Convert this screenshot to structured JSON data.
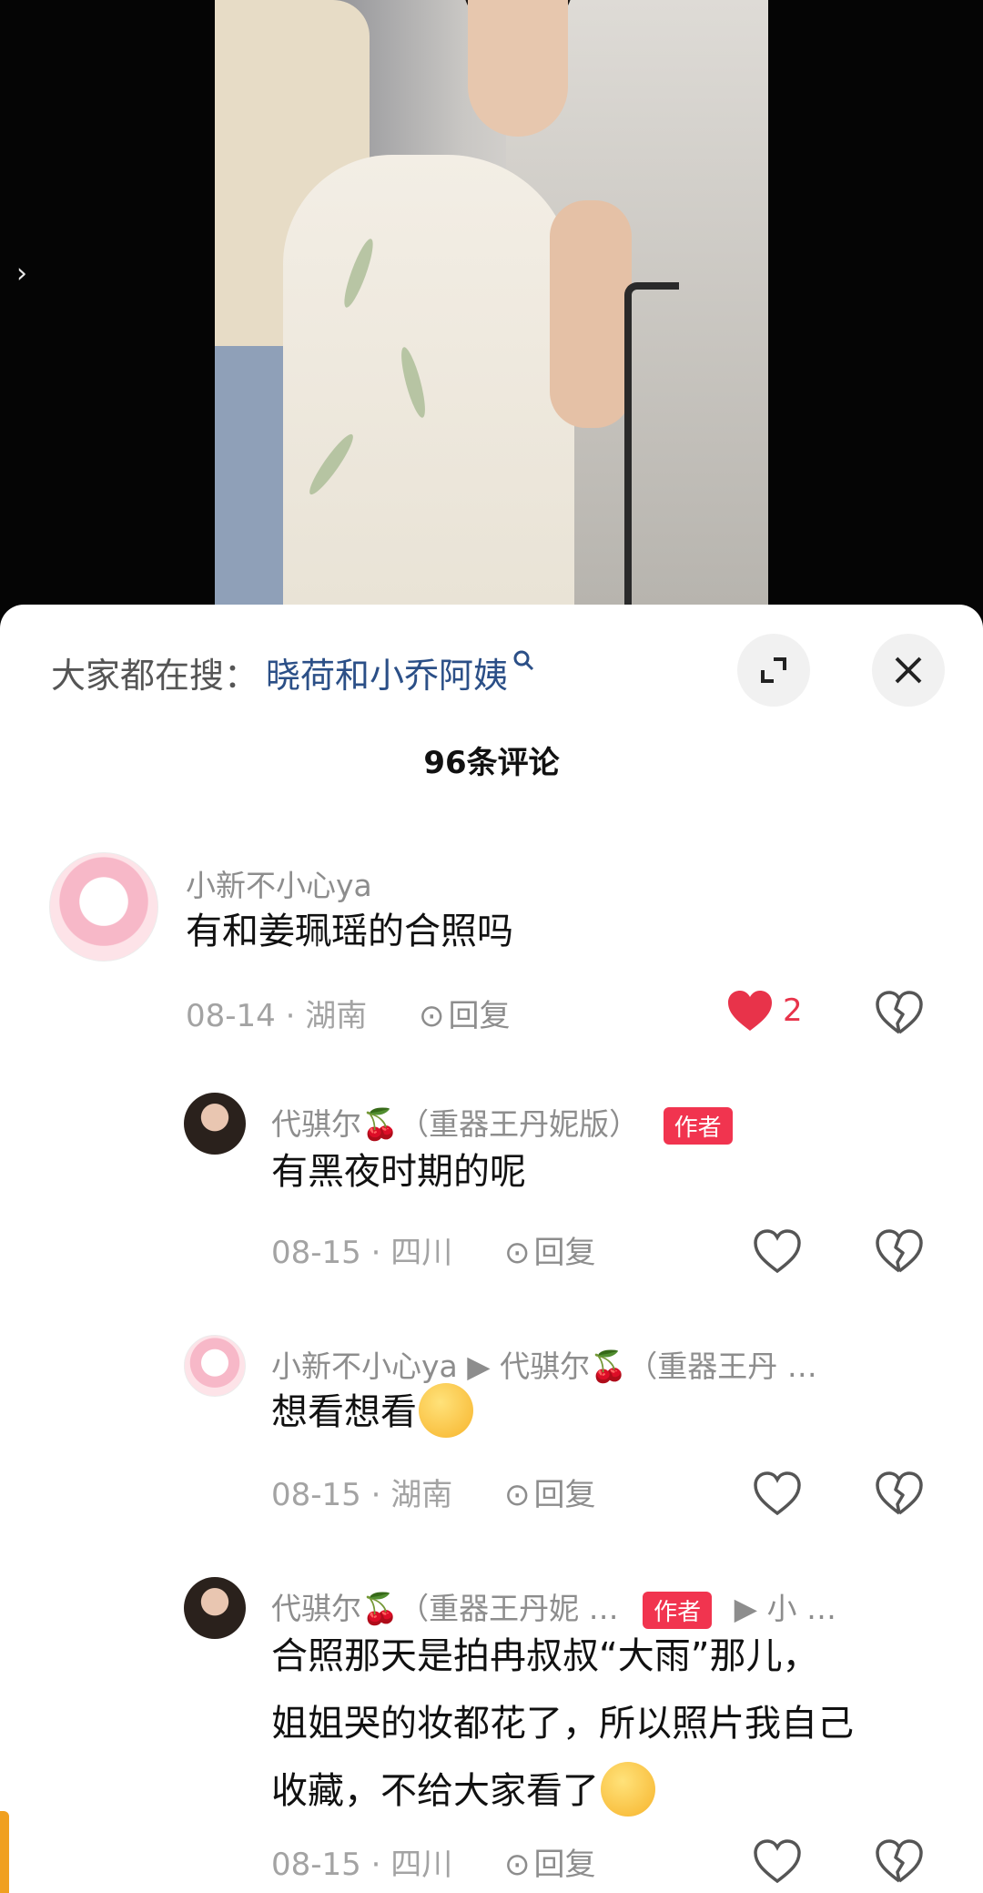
{
  "search": {
    "label": "大家都在搜：",
    "term": "晓荷和小乔阿姨"
  },
  "comment_count": "96条评论",
  "colors": {
    "like_red": "#e8334a",
    "author_badge": "#f1344f",
    "link_blue": "#2b4f87"
  },
  "comments": [
    {
      "name": "小新不小心ya",
      "text": "有和姜珮瑶的合照吗",
      "date": "08-14 · 湖南",
      "reply_label": "回复",
      "likes": "2",
      "liked": true
    },
    {
      "name": "代骐尔🍒（重器王丹妮版）",
      "badge": "作者",
      "text": "有黑夜时期的呢",
      "date": "08-15 · 四川",
      "reply_label": "回复"
    },
    {
      "name": "小新不小心ya ▶ 代骐尔🍒（重器王丹 …",
      "text": "想看想看",
      "date": "08-15 · 湖南",
      "reply_label": "回复"
    },
    {
      "name": "代骐尔🍒（重器王丹妮 …",
      "badge": "作者",
      "reply_to": "▶ 小 …",
      "text_lines": [
        "合照那天是拍冉叔叔“大雨”那儿，",
        "姐姐哭的妆都花了，所以照片我自己",
        "收藏，不给大家看了"
      ],
      "date": "08-15 · 四川",
      "reply_label": "回复"
    }
  ]
}
